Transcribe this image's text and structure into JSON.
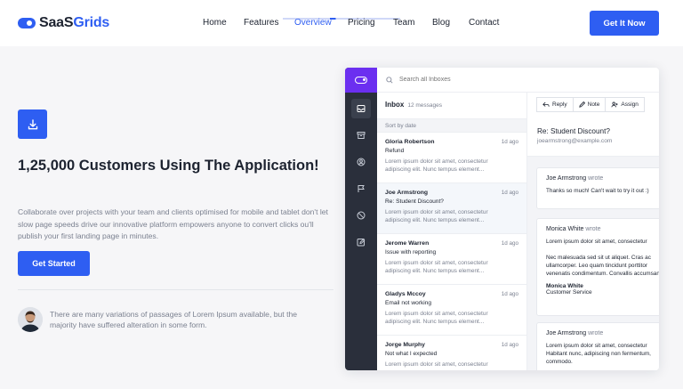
{
  "header": {
    "logo": {
      "part1": "SaaS",
      "part2": "Grids"
    },
    "nav": [
      "Home",
      "Features",
      "Overview",
      "Pricing",
      "Team",
      "Blog",
      "Contact"
    ],
    "active_nav": "Overview",
    "cta_label": "Get It Now"
  },
  "hero": {
    "icon": "download-icon",
    "title": "1,25,000 Customers Using The Application!",
    "description": "Collaborate over projects with your team and clients optimised for mobile and tablet don't let slow page speeds drive our innovative platform empowers anyone to convert clicks ou'll publish your first landing page in minutes.",
    "button_label": "Get Started",
    "testimonial": "There are many variations of passages of Lorem Ipsum available, but the majority have suffered alteration in some form."
  },
  "app": {
    "search_placeholder": "Search all Inboxes",
    "inbox": {
      "title": "Inbox",
      "count": "12 messages",
      "sort_label": "Sort by date",
      "messages": [
        {
          "name": "Gloria Robertson",
          "time": "1d ago",
          "subject": "Refund",
          "body": "Lorem ipsum dolor sit amet, consectetur adipiscing elit. Nunc tempus element..."
        },
        {
          "name": "Joe Armstrong",
          "time": "1d ago",
          "subject": "Re: Student Discount?",
          "body": "Lorem ipsum dolor sit amet, consectetur adipiscing elit. Nunc tempus element..."
        },
        {
          "name": "Jerome Warren",
          "time": "1d ago",
          "subject": "Issue with reporting",
          "body": "Lorem ipsum dolor sit amet, consectetur adipiscing elit. Nunc tempus element..."
        },
        {
          "name": "Gladys Mccoy",
          "time": "1d ago",
          "subject": "Email not working",
          "body": "Lorem ipsum dolor sit amet, consectetur adipiscing elit. Nunc tempus element..."
        },
        {
          "name": "Jorge Murphy",
          "time": "1d ago",
          "subject": "Not what I expected",
          "body": "Lorem ipsum dolor sit amet, consectetur"
        }
      ]
    },
    "thread": {
      "actions": [
        "Reply",
        "Note",
        "Assign"
      ],
      "subject": "Re: Student Discount?",
      "email": "joearmstrong@example.com",
      "wrote": "wrote",
      "cards": [
        {
          "name": "Joe Armstrong",
          "lines": [
            "Thanks so much! Can't wait to try it out :)"
          ]
        },
        {
          "name": "Monica White",
          "lines": [
            "Lorem ipsum dolor sit amet, consectetur",
            "",
            "Nec malesuada sed sit ut aliquet. Cras ac",
            "ullamcorper. Leo quam tincidunt porttitor",
            "venenatis condimentum. Convallis accumsan"
          ],
          "sign_name": "Monica White",
          "sign_role": "Customer Service"
        },
        {
          "name": "Joe Armstrong",
          "lines": [
            "Lorem ipsum dolor sit amet, consectetur",
            "Habitant nunc, adipiscing non fermentum,",
            "commodo."
          ]
        }
      ]
    }
  },
  "colors": {
    "accent": "#2e5ef2",
    "purple": "#6b2ff0",
    "rail": "#2a2f3b"
  }
}
